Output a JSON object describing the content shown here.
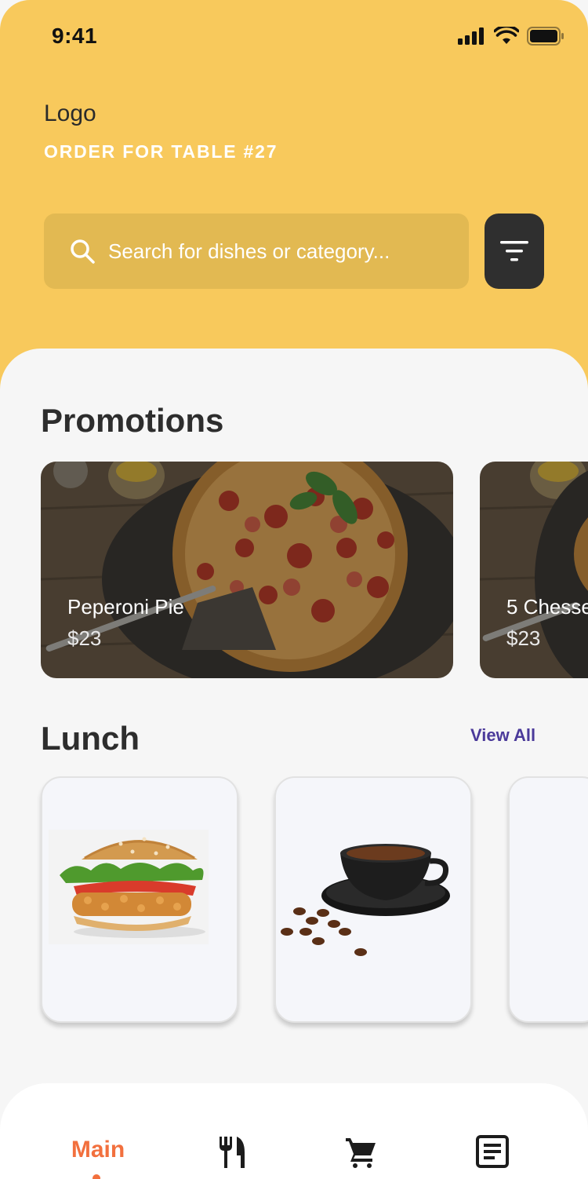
{
  "status_bar": {
    "time": "9:41"
  },
  "header": {
    "logo": "Logo",
    "table_label": "ORDER FOR TABLE #27"
  },
  "search": {
    "placeholder": "Search for dishes or category..."
  },
  "promotions": {
    "title": "Promotions",
    "items": [
      {
        "name": "Peperoni Pie",
        "price": "$23"
      },
      {
        "name": "5 Chesse",
        "price": "$23"
      }
    ]
  },
  "lunch": {
    "title": "Lunch",
    "view_all": "View All",
    "items": [
      {
        "icon": "burger-image"
      },
      {
        "icon": "coffee-image"
      },
      {
        "icon": "empty"
      }
    ]
  },
  "bottom_nav": {
    "items": [
      {
        "label": "Main",
        "active": true
      },
      {
        "icon": "fork-knife-icon"
      },
      {
        "icon": "cart-icon"
      },
      {
        "icon": "orders-list-icon"
      }
    ]
  },
  "colors": {
    "header_bg": "#f8c95c",
    "accent": "#f2703e",
    "link": "#4b3a9a"
  }
}
